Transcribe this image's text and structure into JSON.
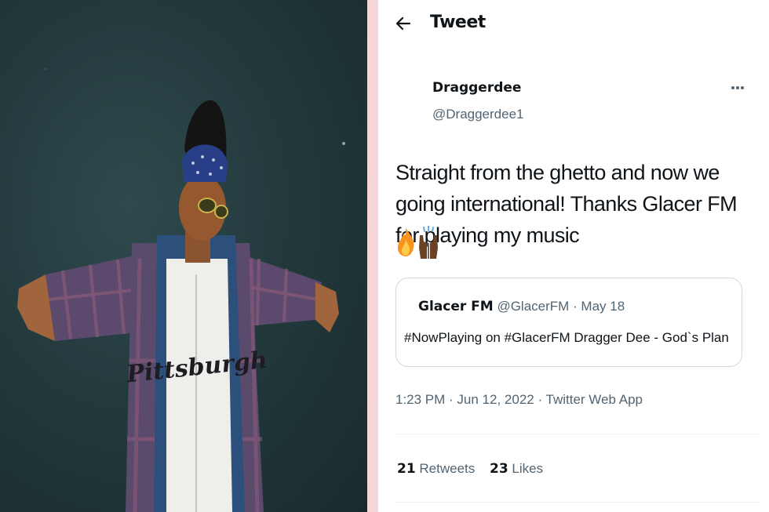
{
  "header": {
    "title": "Tweet"
  },
  "author": {
    "name": "Draggerdee",
    "handle": "@Draggerdee1"
  },
  "tweet": {
    "text": "Straight from the ghetto and now we going international! Thanks Glacer FM for playing my music",
    "emojis": [
      "fire",
      "raised-hands"
    ]
  },
  "quote": {
    "name": "Glacer FM",
    "meta": "@GlacerFM · May 18",
    "text": "#NowPlaying on #GlacerFM Dragger Dee - God`s Plan"
  },
  "timestamp": "1:23 PM · Jun 12, 2022 · Twitter Web App",
  "stats": {
    "retweets_count": "21",
    "retweets_label": "Retweets",
    "likes_count": "23",
    "likes_label": "Likes"
  },
  "photo": {
    "jersey_text": "Pittsburgh"
  },
  "colors": {
    "text_primary": "#0f1419",
    "text_secondary": "#536471",
    "border": "#cfd9de",
    "divider_strip": "#f7d6d7",
    "photo_wall": "#233a3d"
  },
  "icons": {
    "back": "arrow-left-icon",
    "more": "more-horizontal-icon"
  }
}
